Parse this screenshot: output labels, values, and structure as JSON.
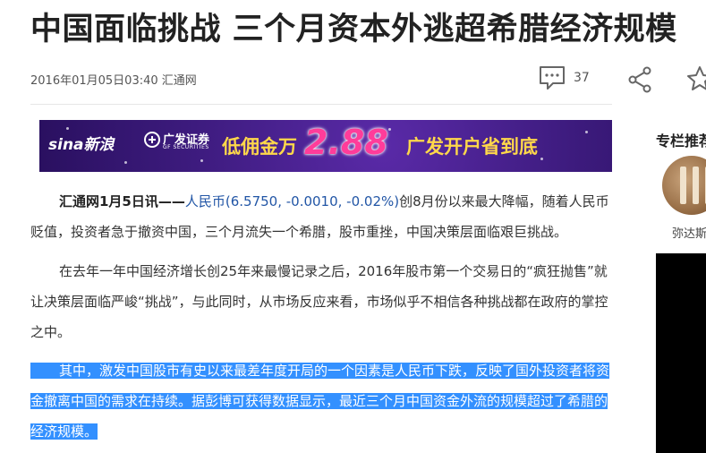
{
  "article": {
    "title": "中国面临挑战 三个月资本外逃超希腊经济规模",
    "date": "2016年01月05日03:40",
    "source": "汇通网",
    "comment_count": "37"
  },
  "ad": {
    "sina_logo": "sina新浪",
    "gf_name": "广发证券",
    "gf_sub": "GF SECURITIES",
    "text_left": "低佣金万",
    "number": "2.88",
    "text_right": "广发开户省到底"
  },
  "paragraphs": {
    "p1_lead": "汇通网1月5日讯——",
    "p1_link": "人民币(6.5750, -0.0010, -0.02%)",
    "p1_rest": "创8月份以来最大降幅，随着人民币贬值，投资者急于撤资中国，三个月流失一个希腊，股市重挫，中国决策层面临艰巨挑战。",
    "p2": "在去年一年中国经济增长创25年来最慢记录之后，2016年股市第一个交易日的“疯狂抛售”就让决策层面临严峻“挑战”，与此同时，从市场反应来看，市场似乎不相信各种挑战都在政府的掌控之中。",
    "p3": "其中，激发中国股市有史以来最差年度开局的一个因素是人民币下跌，反映了国外投资者将资金撤离中国的需求在持续。据彭博可获得数据显示，最近三个月中国资金外流的规模超过了希腊的经济规模。"
  },
  "sidebar": {
    "title": "专栏推荐",
    "author_name": "弥达斯"
  },
  "icons": [
    "comment-icon",
    "share-icon",
    "star-icon",
    "avatar"
  ],
  "colors": {
    "link": "#2256a6",
    "selection": "#3390ff",
    "ad_background": "#3d1b7e",
    "ad_yellow": "#ffd84a",
    "ad_pink": "#ff3c9a"
  }
}
